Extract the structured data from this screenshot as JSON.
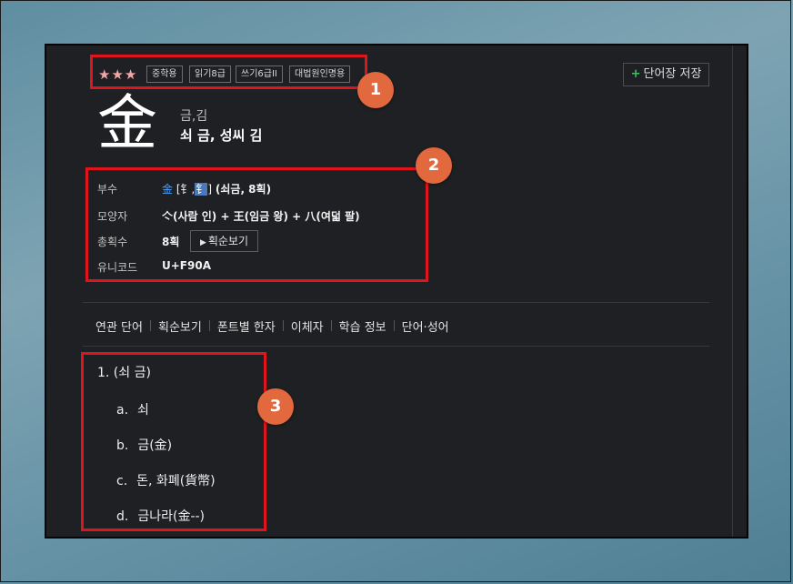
{
  "header": {
    "stars": "★★★",
    "tags": [
      "중학용",
      "읽기8급",
      "쓰기6급II",
      "대법원인명용"
    ],
    "save_label": "단어장 저장"
  },
  "character": {
    "hanja": "金",
    "reading": "금,김",
    "meaning": "쇠 금, 성씨 김"
  },
  "info": {
    "radical_label": "부수",
    "radical_char": "金",
    "radical_open": " [",
    "radical_var1": "钅",
    "radical_comma": ",",
    "radical_var2": "钅",
    "radical_close": "] ",
    "radical_desc": "(쇠금, 8획)",
    "shape_label": "모양자",
    "shape_value": "亽(사람 인) + 王(임금 왕) + 八(여덟 팔)",
    "strokes_label": "총획수",
    "strokes_value": "8획",
    "stroke_order_button": "획순보기",
    "unicode_label": "유니코드",
    "unicode_value": "U+F90A"
  },
  "tabs": [
    "연관 단어",
    "획순보기",
    "폰트별 한자",
    "이체자",
    "학습 정보",
    "단어·성어"
  ],
  "definitions": {
    "heading": "1.  (쇠 금)",
    "items": [
      {
        "letter": "a.",
        "text": "쇠"
      },
      {
        "letter": "b.",
        "text": "금(金)"
      },
      {
        "letter": "c.",
        "text": "돈, 화폐(貨幣)"
      },
      {
        "letter": "d.",
        "text": "금나라(金--)"
      }
    ]
  },
  "annotations": [
    "1",
    "2",
    "3"
  ],
  "colors": {
    "highlight": "#e0141c",
    "badge": "#e2683e",
    "panel_bg": "#1f2023",
    "stars": "#f2a6a6",
    "link": "#4aa3ff"
  }
}
